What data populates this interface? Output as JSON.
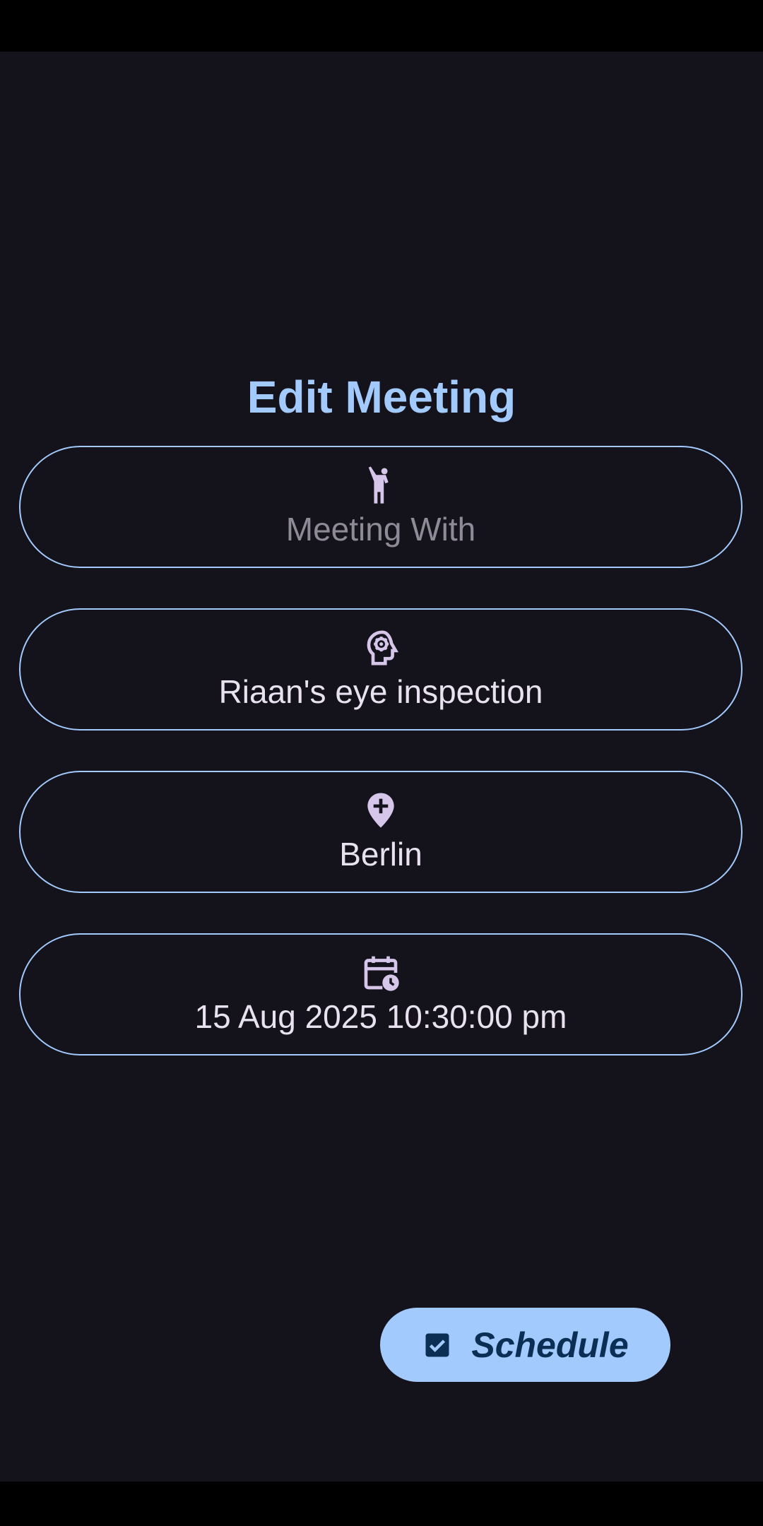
{
  "screen": {
    "title": "Edit Meeting"
  },
  "fields": {
    "meeting_with": {
      "placeholder": "Meeting With",
      "value": "",
      "icon": "person-waving-icon"
    },
    "description": {
      "value": "Riaan's eye inspection",
      "icon": "psychology-head-icon"
    },
    "location": {
      "value": "Berlin",
      "icon": "add-location-icon"
    },
    "datetime": {
      "value": "15 Aug 2025 10:30:00 pm",
      "icon": "calendar-clock-icon"
    }
  },
  "actions": {
    "schedule_label": "Schedule",
    "schedule_icon": "checkbox-checked-icon"
  },
  "colors": {
    "background": "#14121b",
    "accent": "#a2cafd",
    "icon": "#d6c6ea",
    "text": "#e8e1ef",
    "placeholder": "#8f8a97",
    "fab_text": "#0b2f54"
  }
}
